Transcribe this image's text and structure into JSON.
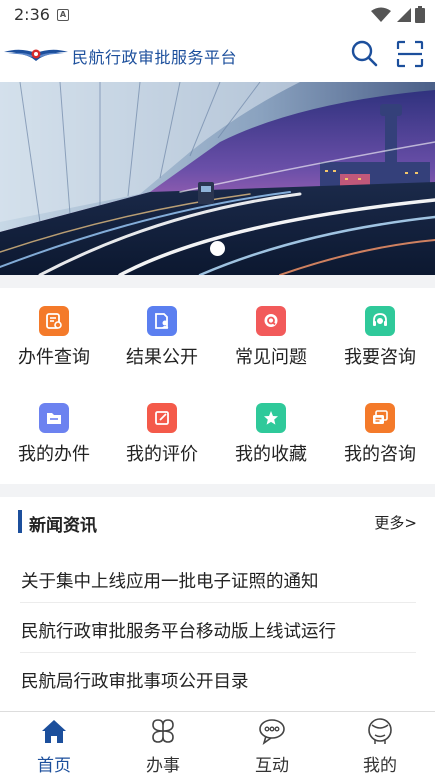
{
  "status_bar": {
    "time": "2:36",
    "notification_letter": "A"
  },
  "header": {
    "title": "民航行政审批服务平台"
  },
  "banner": {
    "active_slide": 1
  },
  "quick_grid": {
    "items": [
      {
        "label": "办件查询",
        "icon": "document-search-icon",
        "color": "#f47a2a"
      },
      {
        "label": "结果公开",
        "icon": "document-user-icon",
        "color": "#5b7ff0"
      },
      {
        "label": "常见问题",
        "icon": "question-chat-icon",
        "color": "#f25a5a"
      },
      {
        "label": "我要咨询",
        "icon": "headset-icon",
        "color": "#2fc99a"
      },
      {
        "label": "我的办件",
        "icon": "folder-icon",
        "color": "#6c82f0"
      },
      {
        "label": "我的评价",
        "icon": "edit-note-icon",
        "color": "#f45a4a"
      },
      {
        "label": "我的收藏",
        "icon": "star-icon",
        "color": "#2fc99a"
      },
      {
        "label": "我的咨询",
        "icon": "chat-bubbles-icon",
        "color": "#f47a2a"
      }
    ]
  },
  "news": {
    "title": "新闻资讯",
    "more": "更多>",
    "items": [
      "关于集中上线应用一批电子证照的通知",
      "民航行政审批服务平台移动版上线试运行",
      "民航局行政审批事项公开目录"
    ]
  },
  "tabs": [
    {
      "label": "首页",
      "icon": "home-icon",
      "active": true
    },
    {
      "label": "办事",
      "icon": "services-icon",
      "active": false
    },
    {
      "label": "互动",
      "icon": "interaction-icon",
      "active": false
    },
    {
      "label": "我的",
      "icon": "profile-icon",
      "active": false
    }
  ],
  "colors": {
    "brand": "#1c4f9c",
    "divider": "#f2f3f5"
  }
}
